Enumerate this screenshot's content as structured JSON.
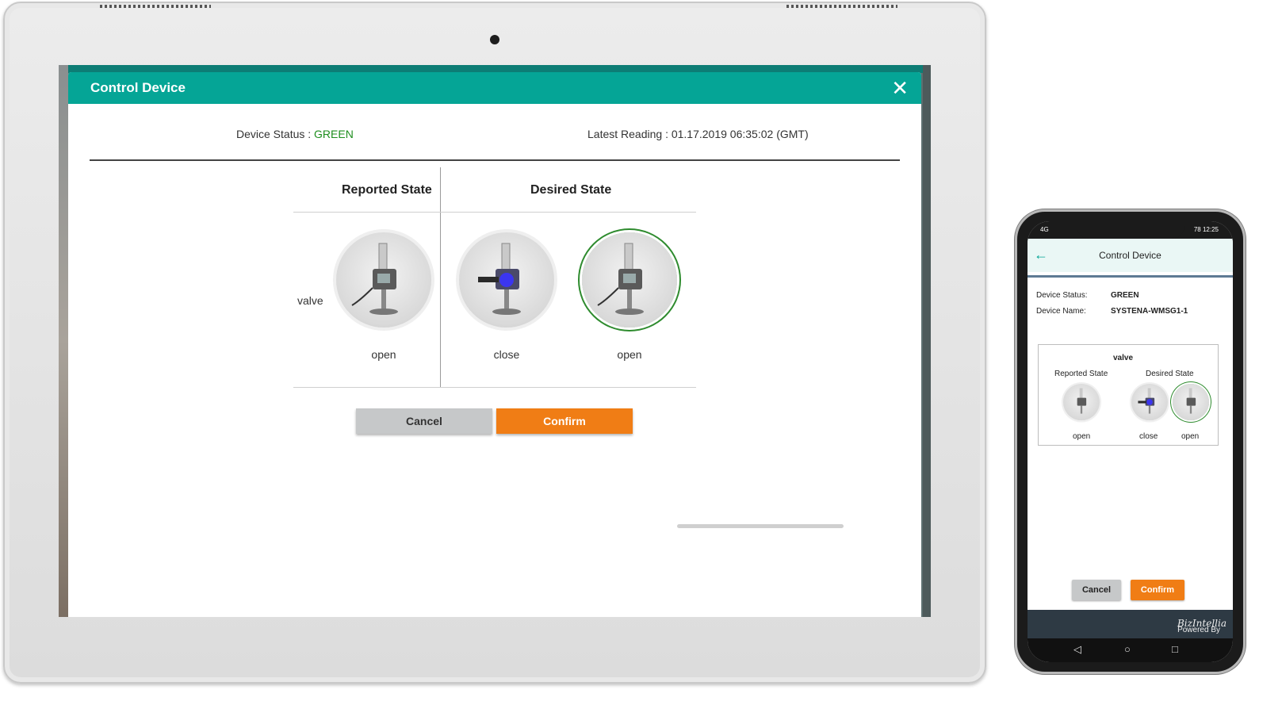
{
  "tablet": {
    "dialog": {
      "title": "Control Device",
      "device_status_label": "Device Status : ",
      "device_status_value": "GREEN",
      "latest_reading": "Latest Reading : 01.17.2019 06:35:02 (GMT)",
      "reported_state_header": "Reported State",
      "desired_state_header": "Desired State",
      "row_label": "valve",
      "reported_value": "open",
      "desired_options": [
        "close",
        "open"
      ],
      "selected_desired": "open",
      "cancel_label": "Cancel",
      "confirm_label": "Confirm"
    }
  },
  "phone": {
    "status_left": "4G",
    "status_right": "78 12:25",
    "title": "Control Device",
    "device_status_label": "Device Status:",
    "device_status_value": "GREEN",
    "device_name_label": "Device Name:",
    "device_name_value": "SYSTENA-WMSG1-1",
    "row_label": "valve",
    "reported_state_header": "Reported State",
    "desired_state_header": "Desired State",
    "reported_value": "open",
    "desired_options": [
      "close",
      "open"
    ],
    "cancel_label": "Cancel",
    "confirm_label": "Confirm",
    "footer_prefix": "Powered By",
    "footer_brand": "BizIntellia"
  },
  "colors": {
    "header_teal": "#05a596",
    "confirm_orange": "#f07d15",
    "cancel_gray": "#c6c8c9",
    "status_green": "#1e8e1e"
  }
}
